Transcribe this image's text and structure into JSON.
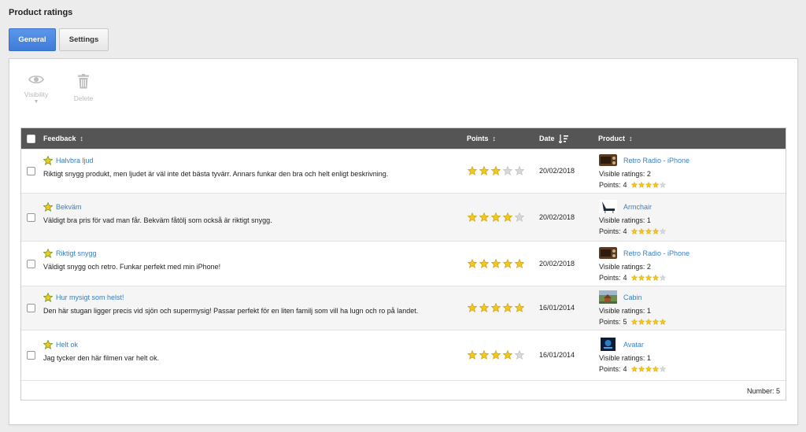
{
  "page": {
    "title": "Product ratings"
  },
  "tabs": [
    {
      "label": "General",
      "active": true
    },
    {
      "label": "Settings",
      "active": false
    }
  ],
  "toolbar": {
    "visibility_label": "Visibility",
    "visibility_caret": "▼",
    "delete_label": "Delete"
  },
  "table": {
    "headers": {
      "feedback": "Feedback",
      "points": "Points",
      "date": "Date",
      "product": "Product"
    },
    "visible_ratings_label": "Visible ratings:",
    "points_label": "Points:",
    "rows": [
      {
        "title": "Halvbra ljud",
        "text": "Riktigt snygg produkt, men ljudet är väl inte det bästa tyvärr. Annars funkar den bra och helt enligt beskrivning.",
        "rating": 3,
        "date": "20/02/2018",
        "product": "Retro Radio - iPhone",
        "product_icon": "radio-thumbnail",
        "visible_ratings": "2",
        "product_points": "4",
        "product_points_value": 4
      },
      {
        "title": "Bekväm",
        "text": "Väldigt bra pris för vad man får. Bekväm fåtölj som också är riktigt snygg.",
        "rating": 4,
        "date": "20/02/2018",
        "product": "Armchair",
        "product_icon": "armchair-thumbnail",
        "visible_ratings": "1",
        "product_points": "4",
        "product_points_value": 4
      },
      {
        "title": "Riktigt snygg",
        "text": "Väldigt snygg och retro. Funkar perfekt med min iPhone!",
        "rating": 5,
        "date": "20/02/2018",
        "product": "Retro Radio - iPhone",
        "product_icon": "radio-thumbnail",
        "visible_ratings": "2",
        "product_points": "4",
        "product_points_value": 4
      },
      {
        "title": "Hur mysigt som helst!",
        "text": "Den här stugan ligger precis vid sjön och supermysig! Passar perfekt för en liten familj som vill ha lugn och ro på landet.",
        "rating": 5,
        "date": "16/01/2014",
        "product": "Cabin",
        "product_icon": "cabin-thumbnail",
        "visible_ratings": "1",
        "product_points": "5",
        "product_points_value": 5
      },
      {
        "title": "Helt ok",
        "text": "Jag tycker den här filmen var helt ok.",
        "rating": 4,
        "date": "16/01/2014",
        "product": "Avatar",
        "product_icon": "movie-thumbnail",
        "visible_ratings": "1",
        "product_points": "4",
        "product_points_value": 4
      }
    ],
    "footer": "Number: 5"
  },
  "colors": {
    "accent": "#3f7bd9",
    "link": "#3a7fc1",
    "header_bg": "#555555",
    "star_on": "#f2c81e",
    "star_off": "#d8d8d8"
  }
}
